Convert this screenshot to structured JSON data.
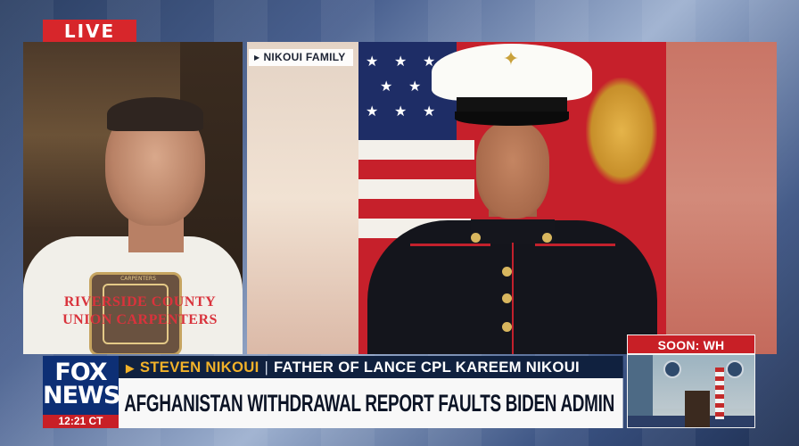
{
  "live_badge": "LIVE",
  "photo_source": "NIKOUI FAMILY",
  "guest_shirt": {
    "line1": "RIVERSIDE COUNTY",
    "line2": "UNION CARPENTERS",
    "logo_arc": "CARPENTERS"
  },
  "lower_third": {
    "name": "STEVEN NIKOUI",
    "title": "FATHER OF LANCE CPL KAREEM NIKOUI",
    "headline": "AFGHANISTAN WITHDRAWAL REPORT FAULTS BIDEN ADMIN"
  },
  "network": {
    "logo_line1": "FOX",
    "logo_line2": "NEWS",
    "clock": "12:21 CT",
    "brand_color": "#0d2f75",
    "accent_color": "#c81f26"
  },
  "up_next": {
    "label": "SOON: WH BRIEFING"
  }
}
